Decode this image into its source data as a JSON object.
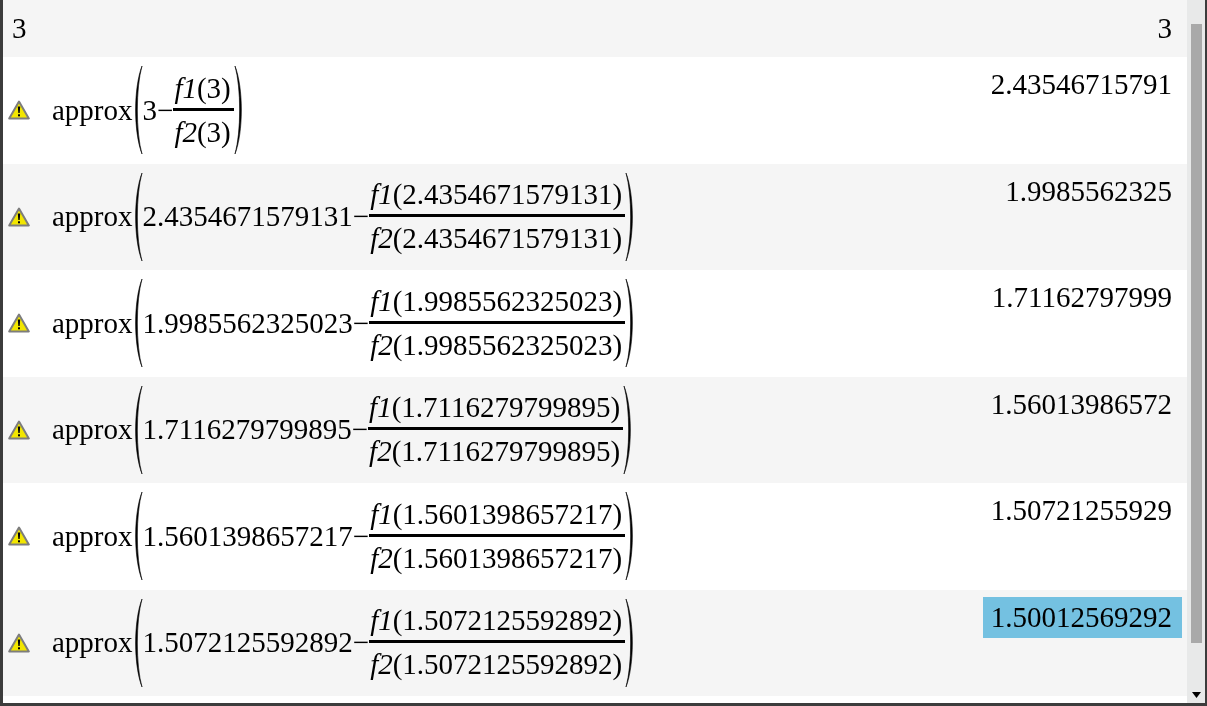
{
  "history": [
    {
      "kind": "plain",
      "input": "3",
      "result": "3",
      "warning": false,
      "selected": false
    },
    {
      "kind": "fraction",
      "warning": true,
      "function": "approx",
      "term": "3",
      "operator": "−",
      "numerator": "*f1*(3)",
      "denominator": "*f2*(3)",
      "result": "2.43546715791",
      "selected": false
    },
    {
      "kind": "fraction",
      "warning": true,
      "function": "approx",
      "term": "2.4354671579131",
      "operator": "−",
      "numerator": "*f1*(2.4354671579131)",
      "denominator": "*f2*(2.4354671579131)",
      "result": "1.9985562325",
      "selected": false
    },
    {
      "kind": "fraction",
      "warning": true,
      "function": "approx",
      "term": "1.9985562325023",
      "operator": "−",
      "numerator": "*f1*(1.9985562325023)",
      "denominator": "*f2*(1.9985562325023)",
      "result": "1.71162797999",
      "selected": false
    },
    {
      "kind": "fraction",
      "warning": true,
      "function": "approx",
      "term": "1.7116279799895",
      "operator": "−",
      "numerator": "*f1*(1.7116279799895)",
      "denominator": "*f2*(1.7116279799895)",
      "result": "1.56013986572",
      "selected": false
    },
    {
      "kind": "fraction",
      "warning": true,
      "function": "approx",
      "term": "1.5601398657217",
      "operator": "−",
      "numerator": "*f1*(1.5601398657217)",
      "denominator": "*f2*(1.5601398657217)",
      "result": "1.50721255929",
      "selected": false
    },
    {
      "kind": "fraction",
      "warning": true,
      "function": "approx",
      "term": "1.5072125592892",
      "operator": "−",
      "numerator": "*f1*(1.5072125592892)",
      "denominator": "*f2*(1.5072125592892)",
      "result": "1.50012569292",
      "selected": true
    }
  ]
}
